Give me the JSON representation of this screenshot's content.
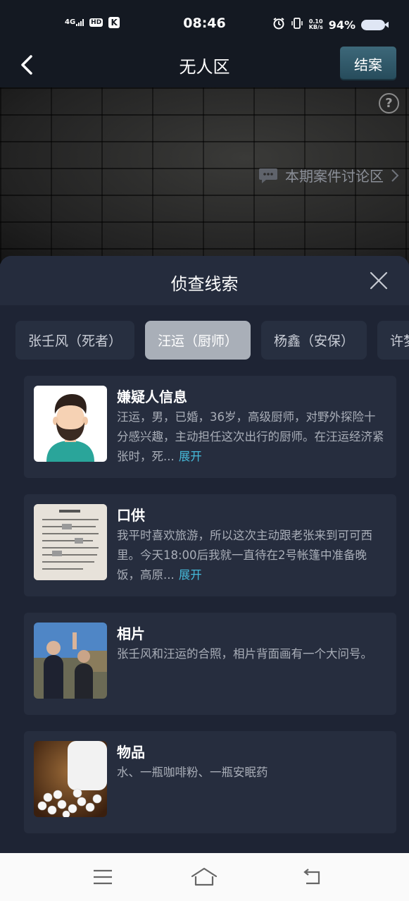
{
  "status_bar": {
    "network": "4G",
    "hd": "HD",
    "k_badge": "K",
    "time": "08:46",
    "speed_value": "0.10",
    "speed_unit": "KB/s",
    "battery": "94%"
  },
  "navbar": {
    "title": "无人区",
    "close_case_label": "结案"
  },
  "scene": {
    "discussion_link": "本期案件讨论区"
  },
  "sheet": {
    "title": "侦查线索",
    "tabs": [
      {
        "label": "张壬风（死者）"
      },
      {
        "label": "汪运（厨师）"
      },
      {
        "label": "杨鑫（安保）"
      },
      {
        "label": "许梦菲"
      }
    ],
    "cards": [
      {
        "title": "嫌疑人信息",
        "body": "汪运，男，已婚，36岁，高级厨师，对野外探险十分感兴趣，主动担任这次出行的厨师。在汪运经济紧张时，死...",
        "expand": "展开"
      },
      {
        "title": "口供",
        "body": "我平时喜欢旅游，所以这次主动跟老张来到可可西里。今天18:00后我就一直待在2号帐篷中准备晚饭，高原...",
        "expand": "展开"
      },
      {
        "title": "相片",
        "body": "张壬风和汪运的合照，相片背面画有一个大问号。"
      },
      {
        "title": "物品",
        "body": "水、一瓶咖啡粉、一瓶安眠药"
      }
    ]
  }
}
